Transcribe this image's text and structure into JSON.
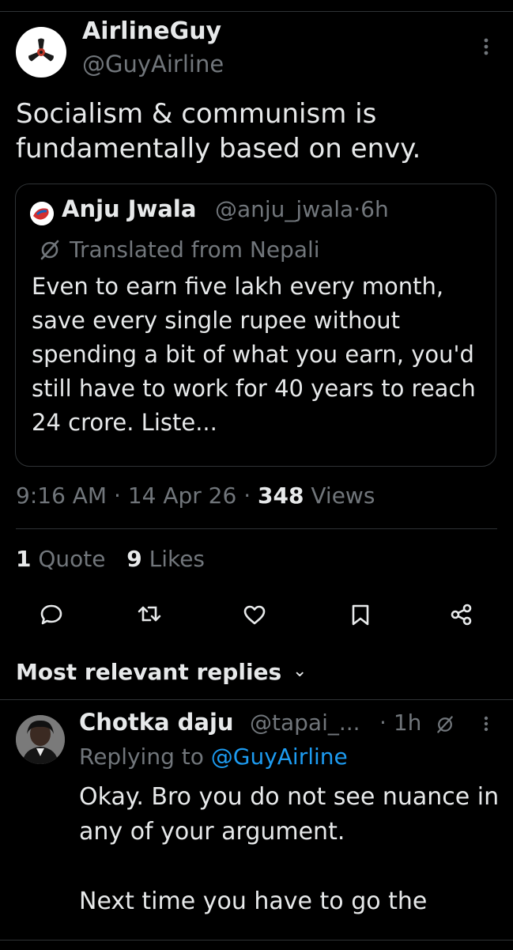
{
  "tweet": {
    "author_name": "AirlineGuy",
    "author_handle": "@GuyAirline",
    "avatar_icon": "propeller-logo",
    "text": "Socialism & communism is fundamentally based on envy.",
    "timestamp_time": "9:16 AM",
    "timestamp_sep1": "·",
    "timestamp_date": "14 Apr 26",
    "timestamp_sep2": "·",
    "views_count": "348",
    "views_label": "Views",
    "quote_count": "1",
    "quote_label": "Quote",
    "likes_count": "9",
    "likes_label": "Likes"
  },
  "quoted": {
    "author_name": "Anju Jwala",
    "author_handle": "@anju_jwala",
    "meta_sep": "·",
    "age": "6h",
    "translated_label": "Translated from Nepali",
    "text": "Even to earn five lakh every month, save every single rupee without spending a bit of what you earn, you'd still have to work for 40 years to reach 24 crore. Liste..."
  },
  "actions": [
    {
      "name": "reply-icon"
    },
    {
      "name": "retweet-icon"
    },
    {
      "name": "like-icon"
    },
    {
      "name": "bookmark-icon"
    },
    {
      "name": "share-icon"
    }
  ],
  "replies_section": {
    "label": "Most relevant replies",
    "chevron": "⌄"
  },
  "reply": {
    "author_name": "Chotka daju",
    "author_handle": "@tapai_...",
    "sep": "·",
    "age": "1h",
    "replying_prefix": "Replying to",
    "replying_handle": "@GuyAirline",
    "text_line1": "Okay. Bro you do not see nuance in any of your argument.",
    "text_line2": "Next time you have to go the"
  },
  "colors": {
    "background": "#000000",
    "text": "#e7e9ea",
    "muted": "#71767b",
    "link": "#1d9bf0",
    "border": "#2f3336"
  }
}
